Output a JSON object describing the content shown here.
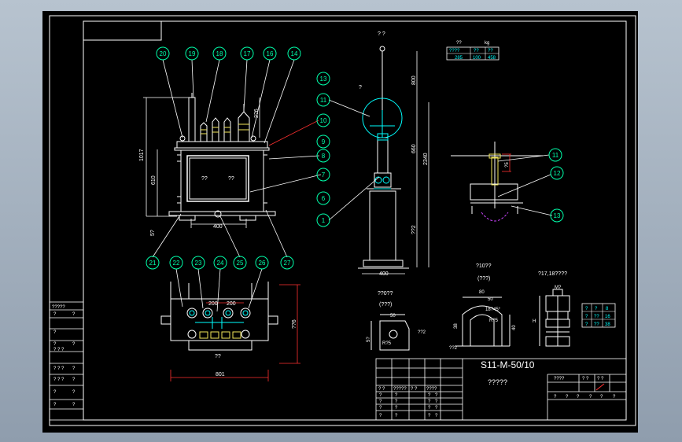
{
  "balloons": {
    "b20": "20",
    "b19": "19",
    "b18": "18",
    "b17": "17",
    "b16": "16",
    "b14": "14",
    "b10": "10",
    "b9": "9",
    "b8": "8",
    "b7": "7",
    "b6": "6",
    "b1": "1",
    "b13": "13",
    "b11": "11",
    "b21": "21",
    "b22": "22",
    "b23": "23",
    "b24": "24",
    "b25": "25",
    "b26": "26",
    "b27": "27",
    "r11": "11",
    "r12": "12",
    "r13": "13"
  },
  "dims": {
    "front_height": "1017",
    "front_inner": "610",
    "front_h2": "2?6",
    "front_base": "5?",
    "front_width": "400",
    "front_label_a": "??",
    "front_label_b": "??",
    "pole_top": "? ?",
    "pole_a": "800",
    "pole_b": "660",
    "pole_c": "2340",
    "pole_d": "??2",
    "pole_width": "400",
    "pole_note": "?",
    "top_width": "801",
    "top_h": "??6",
    "top_d1": "200",
    "top_d2": "200",
    "top_label": "??",
    "bracket_title": "??0??",
    "bracket_sub": "(???)",
    "bracket_w": "50",
    "bracket_h": "5?",
    "bracket_r": "R?5",
    "bracket_d": "??2",
    "saddle_title": "?10??",
    "saddle_sub": "(???)",
    "saddle_w": "80",
    "saddle_w2": "50",
    "saddle_chamfer": "18?45°",
    "saddle_r": "R?5",
    "saddle_h": "38",
    "saddle_h2": "40",
    "saddle_d": "??2",
    "bolt_title": "?17,18????",
    "bolt_m": "M?",
    "bolt_h": "H",
    "detail_dim": "?5"
  },
  "weight_table": {
    "header": "??",
    "unit": "kg",
    "cols": [
      "????",
      "??",
      "??"
    ],
    "vals": [
      "285",
      "100",
      "458"
    ]
  },
  "bolt_table": [
    [
      "?",
      "?",
      "8"
    ],
    [
      "?",
      "??",
      "16"
    ],
    [
      "?",
      "??",
      "38"
    ]
  ],
  "sidebar": {
    "heading": "?????",
    "rows": [
      [
        "?",
        "?"
      ],
      [
        "?",
        ""
      ],
      [
        "?",
        "?"
      ],
      [
        "? ? ?",
        ""
      ],
      [
        "? ? ?",
        "?"
      ],
      [
        "? ? ?",
        "?"
      ],
      [
        "?",
        "?"
      ],
      [
        "?",
        "?"
      ]
    ]
  },
  "title_block": {
    "model": "S11-M-50/10",
    "subtitle": "?????",
    "left_header": [
      "? ?",
      "?????",
      "? ?",
      "????"
    ],
    "left_rows": [
      [
        "?",
        "?",
        "?",
        "?"
      ],
      [
        "?",
        "?",
        "?",
        "?"
      ],
      [
        "?",
        "?",
        "?",
        "?"
      ],
      [
        "?",
        "?",
        "?",
        "?"
      ]
    ],
    "right_header": [
      "????",
      "? ?",
      "? ?"
    ],
    "right_row": [
      "?",
      "?",
      "?",
      "?",
      "?",
      "?"
    ]
  }
}
